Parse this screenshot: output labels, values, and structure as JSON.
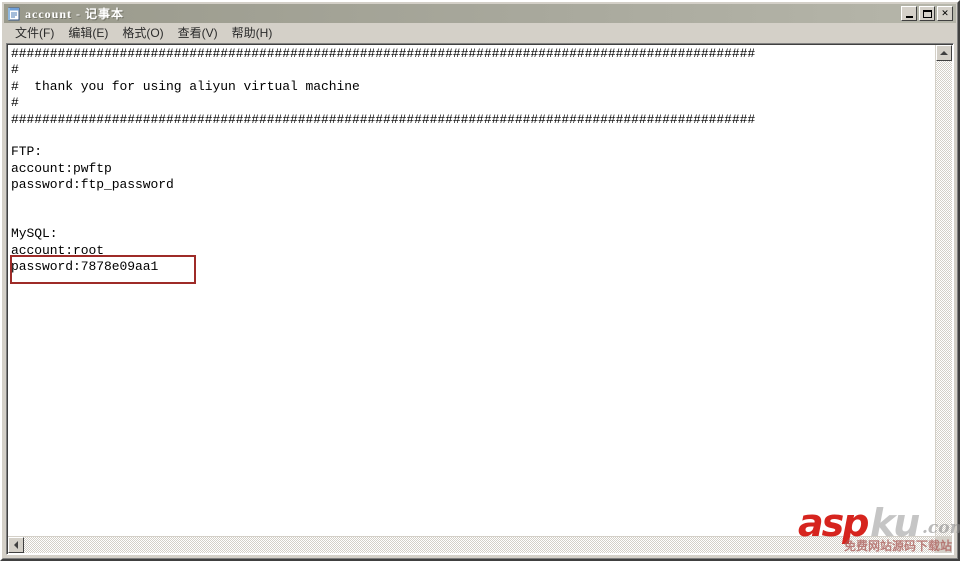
{
  "window": {
    "title": "account - 记事本",
    "icon": "notepad-icon",
    "controls": [
      {
        "name": "minimize",
        "label": "_"
      },
      {
        "name": "maximize",
        "label": "□"
      },
      {
        "name": "close",
        "label": "✕"
      }
    ]
  },
  "menu": {
    "items": [
      {
        "name": "file",
        "label": "文件(F)"
      },
      {
        "name": "edit",
        "label": "编辑(E)"
      },
      {
        "name": "format",
        "label": "格式(O)"
      },
      {
        "name": "view",
        "label": "查看(V)"
      },
      {
        "name": "help",
        "label": "帮助(H)"
      }
    ]
  },
  "document": {
    "text": "################################################################################################\n#\n#  thank you for using aliyun virtual machine\n#\n################################################################################################\n\nFTP:\naccount:pwftp\npassword:ftp_password\n\n\nMySQL:\naccount:root\npassword:7878e09aa1",
    "lines": [
      "################################################################################################",
      "#",
      "#  thank you for using aliyun virtual machine",
      "#",
      "################################################################################################",
      "",
      "FTP:",
      "account:pwftp",
      "password:ftp_password",
      "",
      "",
      "MySQL:",
      "account:root",
      "password:7878e09aa1"
    ],
    "credentials": {
      "ftp": {
        "label": "FTP:",
        "account": "account:pwftp",
        "password": "password:ftp_password"
      },
      "mysql": {
        "label": "MySQL:",
        "account": "account:root",
        "password": "password:7878e09aa1"
      }
    },
    "banner_message": "thank you for using aliyun virtual machine"
  },
  "annotation": {
    "name": "red-highlight-box",
    "target": "password:7878e09aa1",
    "color": "#9e2b28"
  },
  "scrollbars": {
    "vertical": {
      "up_arrow": "▲",
      "down_arrow": "▼"
    },
    "horizontal": {
      "left_arrow": "◀",
      "right_arrow": "▶"
    }
  },
  "watermark": {
    "brand_red": "asp",
    "brand_gray": "ku",
    "tld": ".com",
    "subtitle": "免费网站源码下载站",
    "accent_color": "#d6241e"
  }
}
